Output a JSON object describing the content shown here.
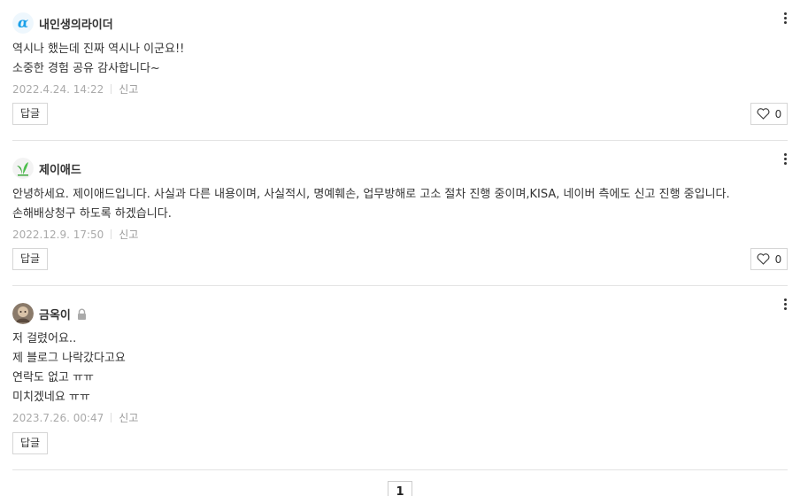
{
  "comments": [
    {
      "nickname": "내인생의라이더",
      "lines": [
        "역시나 했는데 진짜 역시나 이군요!!",
        "소중한 경험 공유 감사합니다~"
      ],
      "date": "2022.4.24. 14:22",
      "report": "신고",
      "reply": "답글",
      "likes": "0",
      "avatar_icon": "alpha-icon"
    },
    {
      "nickname": "제이애드",
      "lines": [
        "안녕하세요. 제이애드입니다. 사실과 다른 내용이며, 사실적시, 명예훼손, 업무방해로 고소 절차 진행 중이며,KISA, 네이버 측에도 신고 진행 중입니다.",
        "손해배상청구 하도록 하겠습니다."
      ],
      "date": "2022.12.9. 17:50",
      "report": "신고",
      "reply": "답글",
      "likes": "0",
      "avatar_icon": "sprout-icon"
    },
    {
      "nickname": "금옥이",
      "lines": [
        "저 걸렸어요..",
        "제 블로그 나락갔다고요",
        "연락도 없고 ㅠㅠ",
        "미치겠네요 ㅠㅠ"
      ],
      "date": "2023.7.26. 00:47",
      "report": "신고",
      "reply": "답글",
      "avatar_icon": "user-photo",
      "locked_icon": "lock-icon"
    }
  ],
  "pagination": {
    "current": "1"
  },
  "colors": {
    "accent_blue": "#1aa0e8",
    "green": "#3aa63a"
  }
}
